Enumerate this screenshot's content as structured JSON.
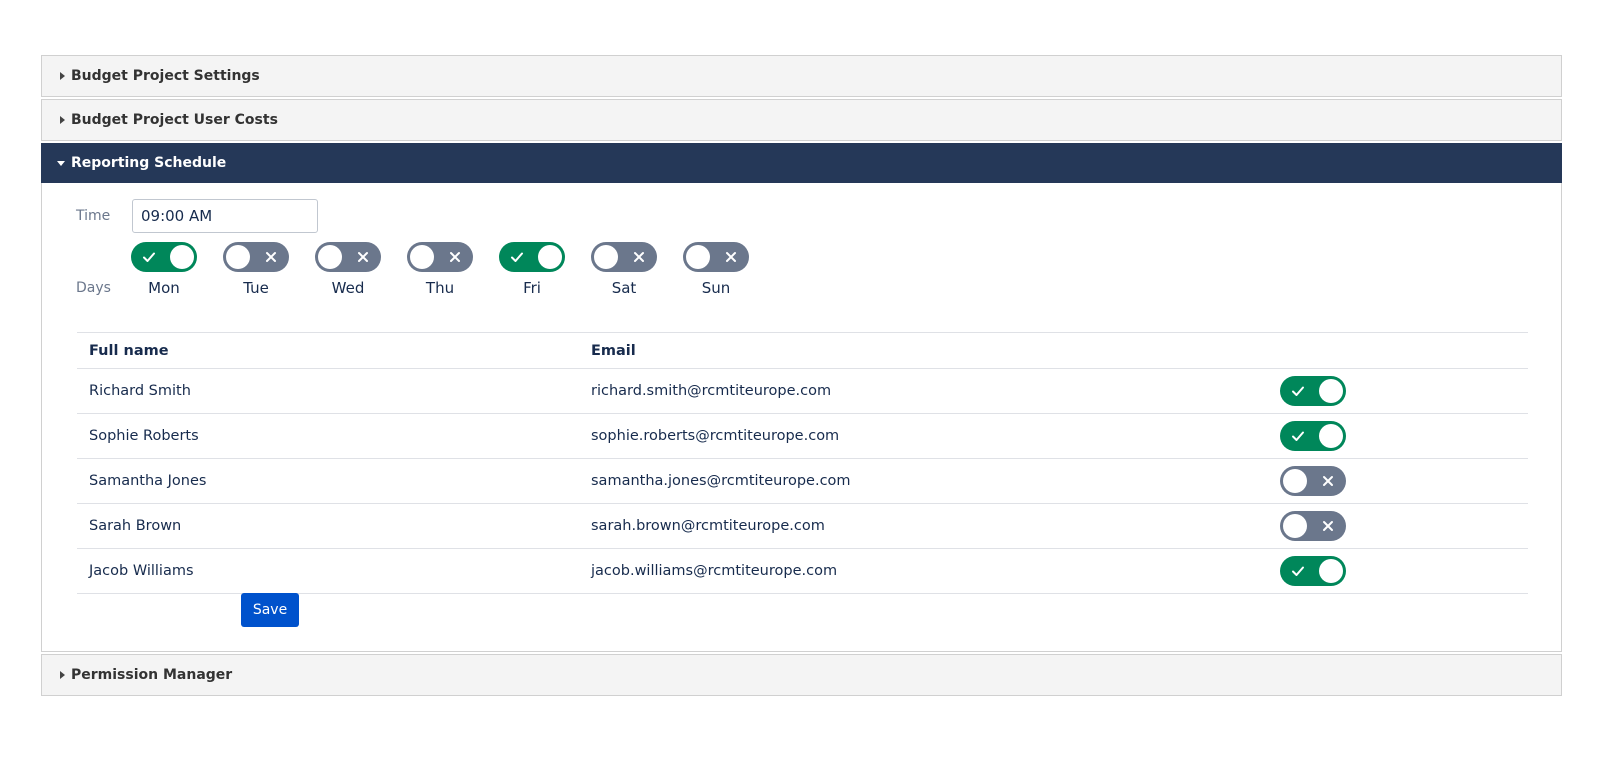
{
  "sections": {
    "settings": "Budget Project Settings",
    "user_costs": "Budget Project User Costs",
    "reporting": "Reporting Schedule",
    "permissions": "Permission Manager"
  },
  "schedule": {
    "time_label": "Time",
    "time_value": "09:00 AM",
    "days_label": "Days",
    "days": [
      {
        "label": "Mon",
        "enabled": true
      },
      {
        "label": "Tue",
        "enabled": false
      },
      {
        "label": "Wed",
        "enabled": false
      },
      {
        "label": "Thu",
        "enabled": false
      },
      {
        "label": "Fri",
        "enabled": true
      },
      {
        "label": "Sat",
        "enabled": false
      },
      {
        "label": "Sun",
        "enabled": false
      }
    ]
  },
  "table": {
    "headers": {
      "full_name": "Full name",
      "email": "Email"
    },
    "rows": [
      {
        "name": "Richard Smith",
        "email": "richard.smith@rcmtiteurope.com",
        "enabled": true
      },
      {
        "name": "Sophie Roberts",
        "email": "sophie.roberts@rcmtiteurope.com",
        "enabled": true
      },
      {
        "name": "Samantha Jones",
        "email": "samantha.jones@rcmtiteurope.com",
        "enabled": false
      },
      {
        "name": "Sarah Brown",
        "email": "sarah.brown@rcmtiteurope.com",
        "enabled": false
      },
      {
        "name": "Jacob Williams",
        "email": "jacob.williams@rcmtiteurope.com",
        "enabled": true
      }
    ]
  },
  "save_label": "Save",
  "colors": {
    "header_active": "#253858",
    "toggle_on": "#00875a",
    "toggle_off": "#6b778c",
    "primary": "#0052cc"
  }
}
